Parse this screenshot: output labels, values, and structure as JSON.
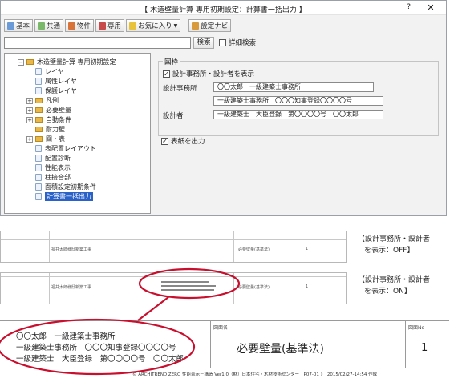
{
  "dialog": {
    "title": "【 木造壁量計算 専用初期設定：計算書一括出力 】",
    "help": "?",
    "close": "✕"
  },
  "toolbar": {
    "basic": "基本",
    "common": "共通",
    "property": "物件",
    "dedicated": "専用",
    "favorites": "お気に入り",
    "favorites_arrow": "▼",
    "settings_navi": "設定ナビ"
  },
  "search": {
    "value": "",
    "button": "検索",
    "detail_label": "詳細検索"
  },
  "tree": {
    "root": "木造壁量計算 専用初期設定",
    "items": [
      "レイヤ",
      "属性レイヤ",
      "保護レイヤ",
      "凡例",
      "必要壁量",
      "自動条件",
      "耐力壁",
      "図・表",
      "表配置レイアウト",
      "配置診断",
      "性能表示",
      "柱接合部",
      "面積設定初期条件",
      "計算書一括出力"
    ]
  },
  "panel": {
    "group_title": "図枠",
    "show_checkbox": "設計事務所・設計者を表示",
    "office_label": "設計事務所",
    "office_line1": "〇〇太郎　一級建築士事務所",
    "office_line2": "一級建築士事務所　〇〇〇知事登録〇〇〇〇号",
    "designer_label": "設計者",
    "designer_value": "一級建築士　大臣登録　第〇〇〇〇号　〇〇太郎",
    "cover_checkbox": "表紙を出力"
  },
  "preview_off": {
    "project": "福井太郎様邸新築工事",
    "drawing": "必要壁量(基準法)",
    "page": "1"
  },
  "preview_on": {
    "project": "福井太郎様邸新築工事",
    "drawing": "必要壁量(基準法)",
    "page": "1"
  },
  "notes": {
    "off_line1": "【設計事務所・設計者",
    "off_line2": "を表示：OFF】",
    "on_line1": "【設計事務所・設計者",
    "on_line2": "を表示：ON】"
  },
  "titleblock": {
    "line1": "〇〇太郎　一級建築士事務所",
    "line2": "一級建築士事務所　〇〇〇知事登録〇〇〇〇号",
    "line3": "一級建築士　大臣登録　第〇〇〇〇号　〇〇太郎",
    "name_caption": "図面名",
    "drawing_name": "必要壁量(基準法)",
    "no_caption": "図面No",
    "page_no": "1",
    "footer": "© ARCHITREND ZERO 性能表示－構造 Ver1.0（財）日本住宅・木材技術センター　P07-01 》　2015/02/27-14:54 作成"
  },
  "colors": {
    "selection": "#2a62c8",
    "highlight_ellipse": "#c8102e",
    "folder": "#e8b84a"
  }
}
